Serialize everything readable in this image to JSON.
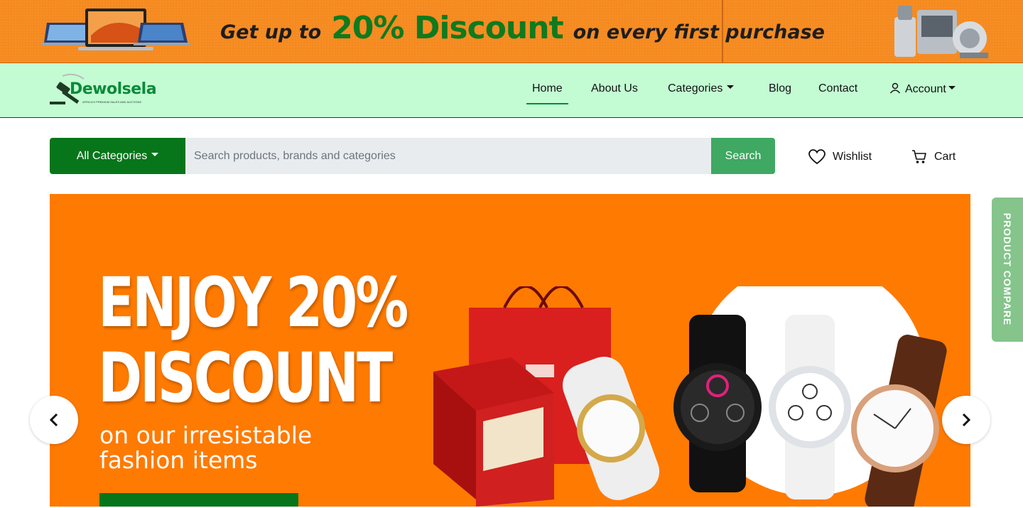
{
  "promo": {
    "text_a": "Get up to",
    "text_b": "20% Discount",
    "text_c": "on every first purchase"
  },
  "brand": {
    "name": "Dewolsela",
    "tagline": "AFRICA'S PREMIUM SALES AND AUCTIONS"
  },
  "nav": {
    "home": "Home",
    "about": "About Us",
    "categories": "Categories",
    "blog": "Blog",
    "contact": "Contact",
    "account": "Account"
  },
  "search": {
    "category_label": "All Categories",
    "placeholder": "Search products, brands and categories",
    "button_label": "Search"
  },
  "actions": {
    "wishlist": "Wishlist",
    "cart": "Cart"
  },
  "hero": {
    "headline_line1": "ENJOY 20%",
    "headline_line2": "DISCOUNT",
    "sub_line1": "on our irresistable",
    "sub_line2": "fashion items"
  },
  "side_tab": {
    "label": "PRODUCT COMPARE"
  },
  "colors": {
    "promo_bg": "#f58a1f",
    "nav_bg": "#c3fcd3",
    "brand_green": "#07751a",
    "search_btn": "#3fa862",
    "hero_bg": "#ff7a00",
    "compare_tab": "#85c48b"
  }
}
